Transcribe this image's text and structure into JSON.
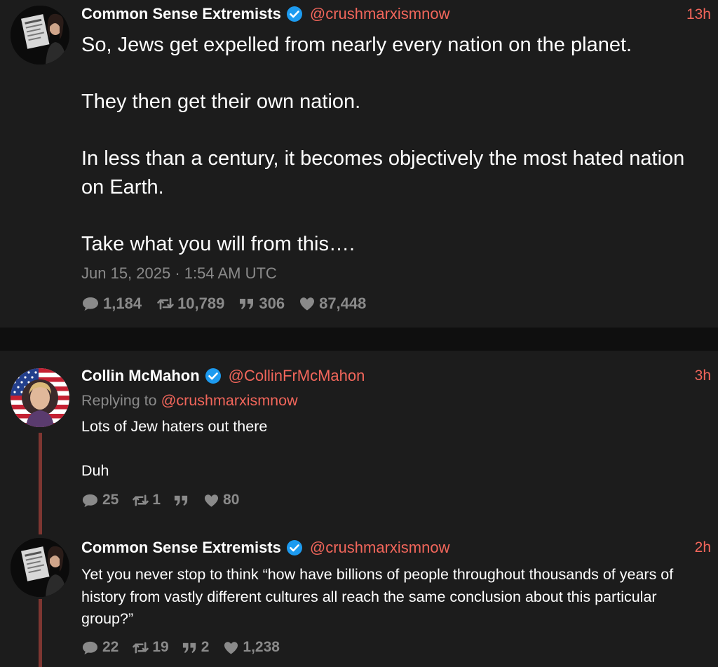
{
  "posts": [
    {
      "author": "Common Sense Extremists",
      "verified": true,
      "handle": "@crushmarxismnow",
      "time": "13h",
      "text": "So, Jews get expelled from nearly every nation on the planet.\n\nThey then get their own nation.\n\nIn less than a century, it becomes objectively the most hated nation on Earth.\n\nTake what you will from this….",
      "date": "Jun 15, 2025 · 1:54 AM UTC",
      "stats": {
        "comments": "1,184",
        "retweets": "10,789",
        "quotes": "306",
        "likes": "87,448"
      }
    },
    {
      "author": "Collin McMahon",
      "verified": true,
      "handle": "@CollinFrMcMahon",
      "time": "3h",
      "replying_label": "Replying to",
      "replying_to": "@crushmarxismnow",
      "text": "Lots of Jew haters out there\n\nDuh",
      "stats": {
        "comments": "25",
        "retweets": "1",
        "quotes": "",
        "likes": "80"
      }
    },
    {
      "author": "Common Sense Extremists",
      "verified": true,
      "handle": "@crushmarxismnow",
      "time": "2h",
      "text": "Yet you never stop to think “how have billions of people throughout thousands of years of history from vastly different cultures all reach the same conclusion about this particular group?”",
      "stats": {
        "comments": "22",
        "retweets": "19",
        "quotes": "2",
        "likes": "1,238"
      }
    }
  ],
  "colors": {
    "background": "#1c1c1c",
    "page_gap": "#0f0f0f",
    "accent": "#f2665b",
    "muted": "#8a8a8a",
    "verified": "#1d9bf0",
    "thread_line": "#7e3631"
  },
  "icons": {
    "comment": "speech-bubble-icon",
    "retweet": "retweet-icon",
    "quote": "quote-icon",
    "like": "heart-icon",
    "verified": "verified-badge-icon"
  }
}
